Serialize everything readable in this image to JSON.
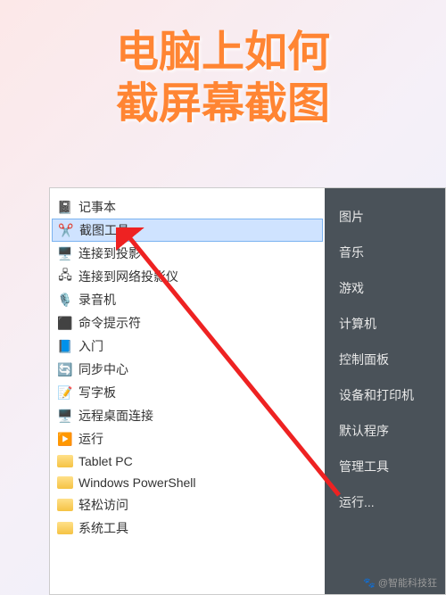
{
  "title_line1": "电脑上如何",
  "title_line2": "截屏幕截图",
  "left_items": [
    {
      "icon": "📓",
      "label": "记事本",
      "highlighted": false
    },
    {
      "icon": "✂️",
      "label": "截图工具",
      "highlighted": true
    },
    {
      "icon": "🖥️",
      "label": "连接到投影",
      "highlighted": false
    },
    {
      "icon": "🖧",
      "label": "连接到网络投影仪",
      "highlighted": false
    },
    {
      "icon": "🎙️",
      "label": "录音机",
      "highlighted": false
    },
    {
      "icon": "⬛",
      "label": "命令提示符",
      "highlighted": false
    },
    {
      "icon": "📘",
      "label": "入门",
      "highlighted": false
    },
    {
      "icon": "🔄",
      "label": "同步中心",
      "highlighted": false
    },
    {
      "icon": "📝",
      "label": "写字板",
      "highlighted": false
    },
    {
      "icon": "🖥️",
      "label": "远程桌面连接",
      "highlighted": false
    },
    {
      "icon": "▶️",
      "label": "运行",
      "highlighted": false
    },
    {
      "icon": "folder",
      "label": "Tablet PC",
      "highlighted": false
    },
    {
      "icon": "folder",
      "label": "Windows PowerShell",
      "highlighted": false
    },
    {
      "icon": "folder",
      "label": "轻松访问",
      "highlighted": false
    },
    {
      "icon": "folder",
      "label": "系统工具",
      "highlighted": false
    }
  ],
  "right_items": [
    "图片",
    "音乐",
    "游戏",
    "计算机",
    "控制面板",
    "设备和打印机",
    "默认程序",
    "管理工具",
    "运行..."
  ],
  "attribution": "🐾 @智能科技狂"
}
